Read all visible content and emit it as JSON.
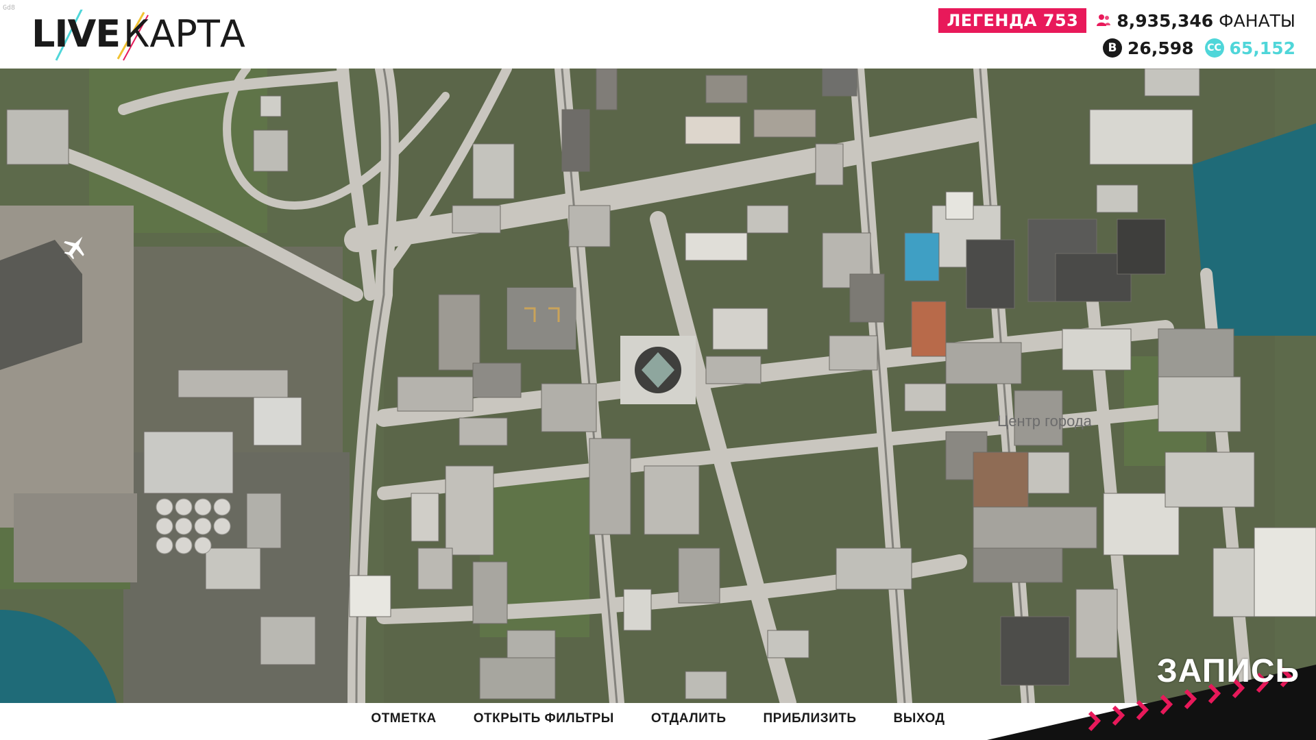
{
  "debug": {
    "fps": "Gd8"
  },
  "logo": {
    "part1": "LIVE",
    "part2": "КАРТА"
  },
  "stats": {
    "legend": "ЛЕГЕНДА 753",
    "fans_count": "8,935,346",
    "fans_label": "ФАНАТЫ",
    "coins_dark": "26,598",
    "coins_cyan": "65,152",
    "coin_dark_symbol": "B",
    "coin_cyan_symbol": "CC"
  },
  "map": {
    "district_label": "Центр города",
    "icons": [
      "airplane-icon"
    ]
  },
  "menu": {
    "items": [
      "ОТМЕТКА",
      "ОТКРЫТЬ ФИЛЬТРЫ",
      "ОТДАЛИТЬ",
      "ПРИБЛИЗИТЬ",
      "ВЫХОД"
    ]
  },
  "record": {
    "label": "ЗАПИСЬ"
  },
  "colors": {
    "accent_pink": "#e8195a",
    "accent_cyan": "#4fd6d9",
    "text_dark": "#1a1a1a",
    "water": "#1f6b78",
    "park": "#5f7448",
    "road": "#c9c6bf"
  }
}
